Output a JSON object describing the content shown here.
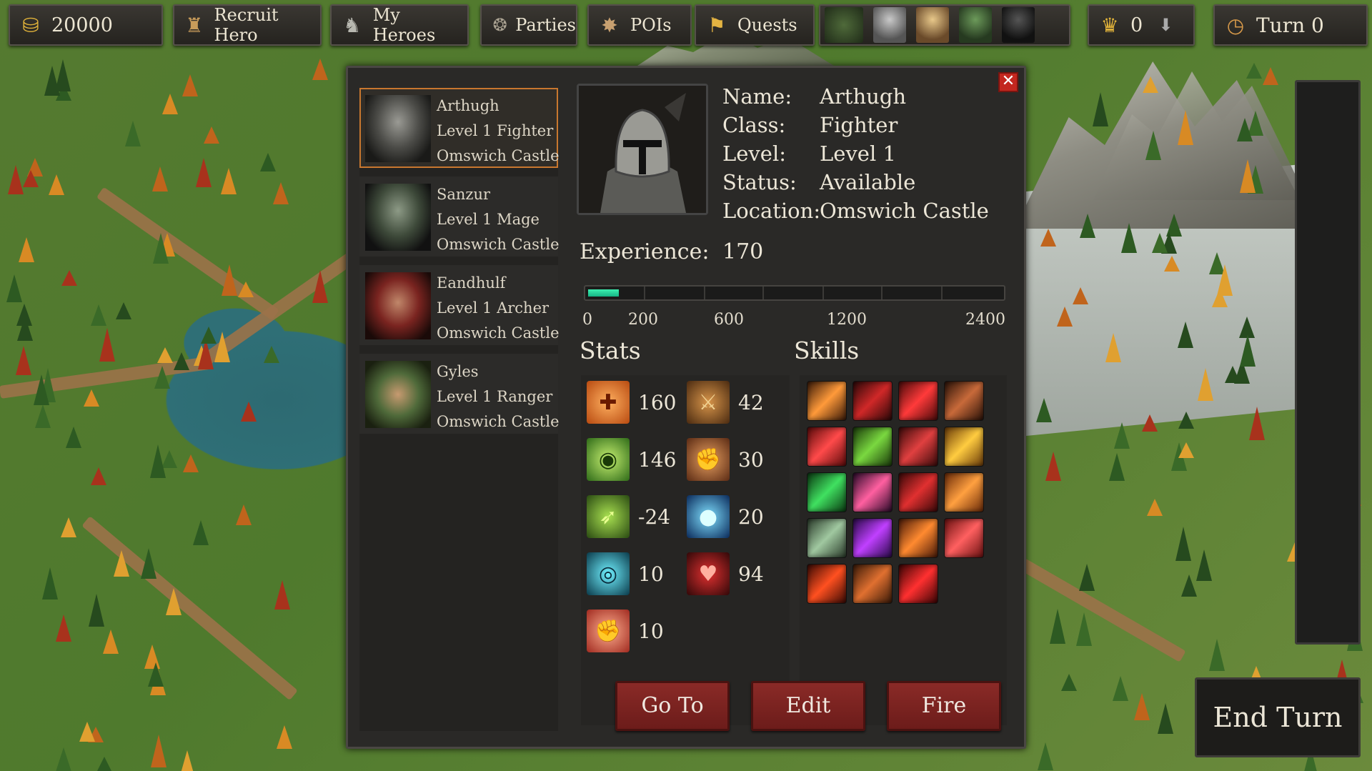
{
  "topbar": {
    "gold": "20000",
    "recruit_hero": "Recruit Hero",
    "my_heroes": "My Heroes",
    "parties": "Parties",
    "pois": "POIs",
    "quests": "Quests",
    "crowns": "0",
    "turn": "Turn 0"
  },
  "heroes": [
    {
      "name": "Arthugh",
      "level_class": "Level 1 Fighter",
      "location": "Omswich Castle",
      "selected": true
    },
    {
      "name": "Sanzur",
      "level_class": "Level 1 Mage",
      "location": "Omswich Castle",
      "selected": false
    },
    {
      "name": "Eandhulf",
      "level_class": "Level 1 Archer",
      "location": "Omswich Castle",
      "selected": false
    },
    {
      "name": "Gyles",
      "level_class": "Level 1 Ranger",
      "location": "Omswich Castle",
      "selected": false
    }
  ],
  "details": {
    "name_label": "Name:",
    "name": "Arthugh",
    "class_label": "Class:",
    "class": "Fighter",
    "level_label": "Level:",
    "level": "Level 1",
    "status_label": "Status:",
    "status": "Available",
    "location_label": "Location:",
    "location": "Omswich Castle",
    "experience_label": "Experience:",
    "experience": "170",
    "experience_fraction": 0.074,
    "exp_marks": [
      "0",
      "200",
      "600",
      "1200",
      "2400"
    ]
  },
  "stats_title": "Stats",
  "skills_title": "Skills",
  "stats": [
    {
      "icon": "health-icon",
      "value": "160"
    },
    {
      "icon": "sword-attack-icon",
      "value": "42"
    },
    {
      "icon": "eye-perception-icon",
      "value": "146"
    },
    {
      "icon": "strength-icon",
      "value": "30"
    },
    {
      "icon": "boot-speed-icon",
      "value": "-24"
    },
    {
      "icon": "mana-orb-icon",
      "value": "20"
    },
    {
      "icon": "shield-ring-icon",
      "value": "10"
    },
    {
      "icon": "heart-crest-icon",
      "value": "94"
    },
    {
      "icon": "fist-icon",
      "value": "10"
    }
  ],
  "skills": [
    "slash-skill-icon",
    "blade-skill-icon",
    "cleave-skill-icon",
    "dagger-skill-icon",
    "rend-skill-icon",
    "mace-skill-icon",
    "axe-skill-icon",
    "strike-skill-icon",
    "poison-blade-skill-icon",
    "whirl-skill-icon",
    "red-blade-skill-icon",
    "rage-face-skill-icon",
    "claw-skill-icon",
    "shadow-skill-icon",
    "crescent-skill-icon",
    "berserk-face-skill-icon",
    "flame-arc-skill-icon",
    "twin-blade-skill-icon",
    "fire-slash-skill-icon"
  ],
  "buttons": {
    "goto": "Go To",
    "edit": "Edit",
    "fire": "Fire",
    "end_turn": "End Turn",
    "close": "✕"
  },
  "colors": {
    "accent": "#c8772f",
    "button": "#7c2320",
    "exp": "#22d39d"
  }
}
